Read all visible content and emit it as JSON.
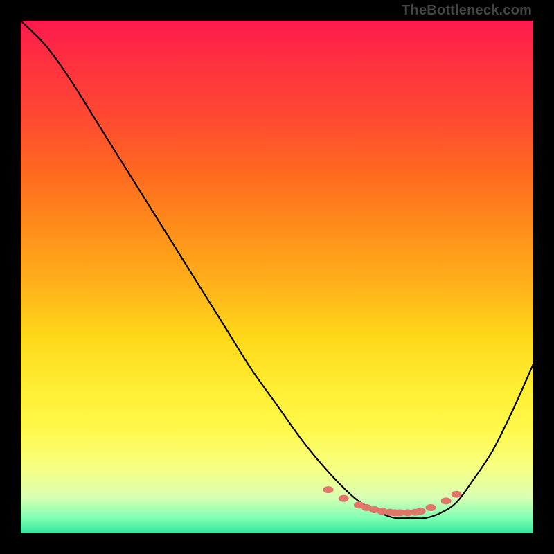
{
  "watermark": "TheBottleneck.com",
  "colors": {
    "curve": "#000000",
    "marker": "#e0766a",
    "gradient_top": "#ff1a4d",
    "gradient_bottom": "#33e69e"
  },
  "chart_data": {
    "type": "line",
    "title": "",
    "xlabel": "",
    "ylabel": "",
    "xlim": [
      0,
      100
    ],
    "ylim": [
      0,
      100
    ],
    "grid": false,
    "series": [
      {
        "name": "bottleneck-curve",
        "x": [
          0,
          5,
          10,
          15,
          20,
          25,
          30,
          35,
          40,
          45,
          50,
          55,
          60,
          65,
          68,
          70,
          73,
          76,
          79,
          82,
          85,
          88,
          92,
          96,
          100
        ],
        "values": [
          100,
          95,
          88,
          80,
          72,
          64,
          56,
          48,
          40,
          32,
          25,
          18,
          12,
          7,
          5,
          4,
          3,
          3,
          3,
          4,
          6,
          10,
          16,
          24,
          33
        ]
      }
    ],
    "markers": {
      "name": "optimal-range",
      "x": [
        60,
        63,
        66,
        67.5,
        69,
        70.5,
        72,
        73,
        74,
        75.5,
        77,
        78,
        80,
        83,
        85
      ],
      "values": [
        8.5,
        6.8,
        5.5,
        5.0,
        4.6,
        4.3,
        4.1,
        4.0,
        4.0,
        4.0,
        4.1,
        4.3,
        5.0,
        6.3,
        7.6
      ]
    },
    "annotations": []
  }
}
